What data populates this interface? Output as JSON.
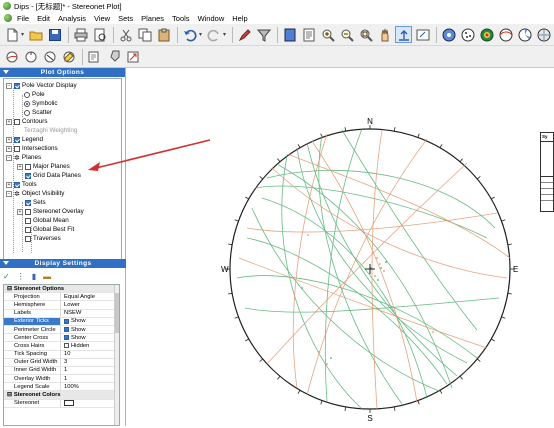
{
  "window": {
    "title": "Dips - [无标题]* - Stereonet Plot]"
  },
  "menu": {
    "items": [
      "File",
      "Edit",
      "Analysis",
      "View",
      "Sets",
      "Planes",
      "Tools",
      "Window",
      "Help"
    ]
  },
  "plot_options": {
    "header": "Plot Options",
    "tree": {
      "pole_vector_display": "Pole Vector Display",
      "pole": "Pole",
      "symbolic": "Symbolic",
      "scatter": "Scatter",
      "contours": "Contours",
      "terzaghi": "Terzaghi Weighting",
      "legend": "Legend",
      "intersections": "Intersections",
      "planes": "Planes",
      "major_planes": "Major Planes",
      "grid_data_planes": "Grid Data Planes",
      "tools": "Tools",
      "object_visibility": "Object Visibility",
      "sets": "Sets",
      "stereonet_overlay": "Stereonet Overlay",
      "global_mean": "Global Mean",
      "global_best_fit": "Global Best Fit",
      "traverses": "Traverses"
    }
  },
  "display_settings": {
    "header": "Display Settings",
    "section_options": "Stereonet Options",
    "section_colors": "Stereonet Colors",
    "rows": [
      {
        "label": "Projection",
        "value": "Equal Angle"
      },
      {
        "label": "Hemisphere",
        "value": "Lower"
      },
      {
        "label": "Labels",
        "value": "NSEW"
      },
      {
        "label": "Exterior Ticks",
        "value": "Show"
      },
      {
        "label": "Perimeter Circle",
        "value": "Show"
      },
      {
        "label": "Center Cross",
        "value": "Show"
      },
      {
        "label": "Cross Hairs",
        "value": "Hidden"
      },
      {
        "label": "Tick Spacing",
        "value": "10"
      },
      {
        "label": "Outer Grid Width",
        "value": "3"
      },
      {
        "label": "Inner Grid Width",
        "value": "1"
      },
      {
        "label": "Overlay Width",
        "value": "1"
      },
      {
        "label": "Legend Scale",
        "value": "100%"
      }
    ],
    "color_row": {
      "label": "Stereonet"
    }
  },
  "stereonet": {
    "labels": {
      "n": "N",
      "s": "S",
      "e": "E",
      "w": "W"
    }
  },
  "colors": {
    "panel_header": "#2f6fc4",
    "green_planes": "#4caf6e",
    "orange_planes": "#e0956a",
    "arrow": "#d03030"
  }
}
